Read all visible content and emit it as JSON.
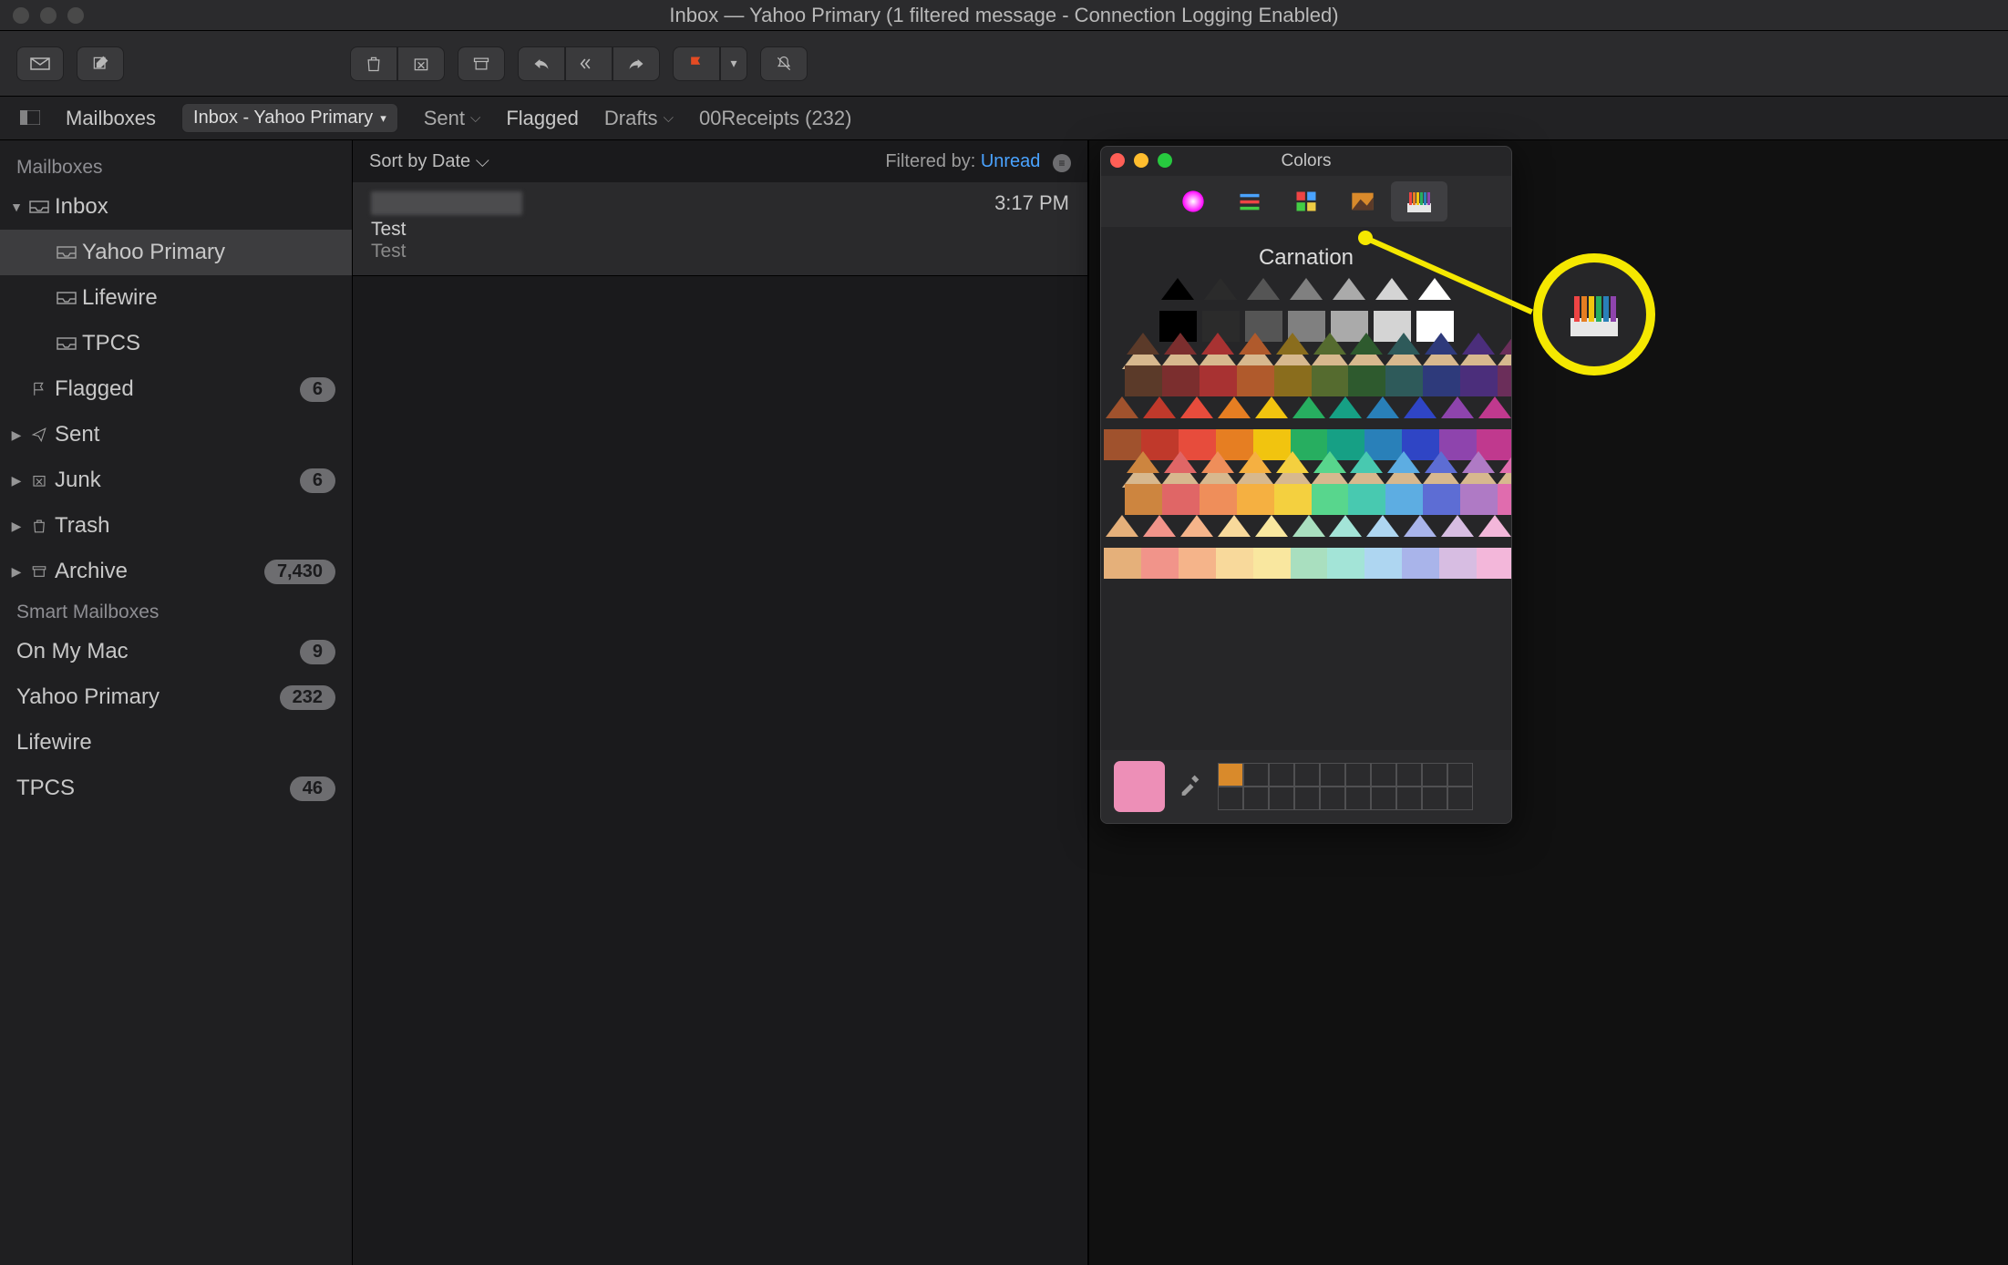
{
  "window_title": "Inbox — Yahoo Primary (1 filtered message - Connection Logging Enabled)",
  "favbar": {
    "mailboxes": "Mailboxes",
    "current": "Inbox - Yahoo Primary",
    "sent": "Sent",
    "flagged": "Flagged",
    "drafts": "Drafts",
    "receipts": "00Receipts (232)"
  },
  "sidebar": {
    "header": "Mailboxes",
    "inbox": "Inbox",
    "inbox_children": [
      {
        "label": "Yahoo Primary",
        "selected": true
      },
      {
        "label": "Lifewire"
      },
      {
        "label": "TPCS"
      }
    ],
    "flagged": {
      "label": "Flagged",
      "count": "6"
    },
    "sent": {
      "label": "Sent"
    },
    "junk": {
      "label": "Junk",
      "count": "6"
    },
    "trash": {
      "label": "Trash"
    },
    "archive": {
      "label": "Archive",
      "count": "7,430"
    },
    "smart": "Smart Mailboxes",
    "onmymac": {
      "label": "On My Mac",
      "count": "9"
    },
    "yahoo": {
      "label": "Yahoo Primary",
      "count": "232"
    },
    "lifewire": {
      "label": "Lifewire"
    },
    "tpcs": {
      "label": "TPCS",
      "count": "46"
    }
  },
  "list": {
    "sort": "Sort by Date",
    "filter_label": "Filtered by:",
    "filter_value": "Unread",
    "msg": {
      "sender": "",
      "time": "3:17 PM",
      "subject": "Test",
      "preview": "Test"
    }
  },
  "colors": {
    "title": "Colors",
    "selected_name": "Carnation",
    "saved_swatch": "#d98a2b",
    "current_swatch": "#ed8fb7",
    "rows": [
      [
        "#000000",
        "#2b2b2b",
        "#555555",
        "#808080",
        "#aaaaaa",
        "#d4d4d4",
        "#ffffff"
      ],
      [
        "#5b3a29",
        "#7b2e2e",
        "#a83232",
        "#b05a2c",
        "#8a6d1d",
        "#556b2f",
        "#2e5a2e",
        "#2e5a5a",
        "#2e3a7b",
        "#4b2e7b",
        "#6b2e5a"
      ],
      [
        "#a0522d",
        "#c0392b",
        "#e74c3c",
        "#e67e22",
        "#f1c40f",
        "#27ae60",
        "#16a085",
        "#2980b9",
        "#2f45c5",
        "#8e44ad",
        "#c0398e"
      ],
      [
        "#cd853f",
        "#e06666",
        "#ef8e5a",
        "#f5b041",
        "#f4d03f",
        "#58d68d",
        "#48c9b0",
        "#5dade2",
        "#5d6dd4",
        "#af7ac5",
        "#e06cae"
      ],
      [
        "#e5b07a",
        "#f1948a",
        "#f5b48a",
        "#f8d99b",
        "#f9e79f",
        "#a9dfbf",
        "#a3e4d7",
        "#aed6f1",
        "#a9b4ea",
        "#d7bde2",
        "#f3b7da"
      ]
    ]
  }
}
